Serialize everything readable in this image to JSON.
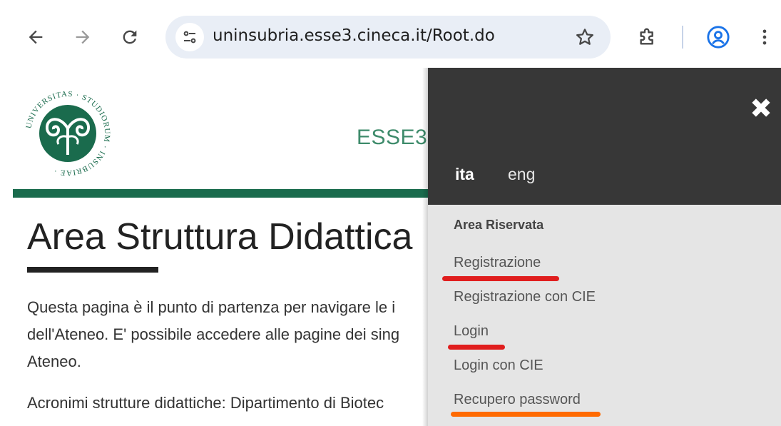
{
  "browser": {
    "url": "uninsubria.esse3.cineca.it/Root.do",
    "icons": {
      "back": "back-arrow-icon",
      "forward": "forward-arrow-icon",
      "reload": "reload-icon",
      "site_settings": "tune-icon",
      "bookmark": "star-icon",
      "extensions": "puzzle-icon",
      "profile": "account-circle-icon",
      "menu": "kebab-menu-icon"
    },
    "colors": {
      "omnibox_bg": "#e9eef6",
      "profile_accent": "#1a73e8"
    }
  },
  "page": {
    "logo": {
      "text": "UNIVERSITAS STUDIORUM INSUBRIAE",
      "color": "#1a6b4d"
    },
    "header_title": "ESSE3",
    "title": "Area Struttura Didattica",
    "intro_lines": [
      "Questa pagina è il punto di partenza per navigare le i",
      "dell'Ateneo. E' possibile accedere alle pagine dei sing",
      "Ateneo."
    ],
    "acronyms": "Acronimi strutture didattiche: Dipartimento di Biotec",
    "colors": {
      "brand_green": "#1a6b4d",
      "title_green": "#3e8b6b"
    }
  },
  "menu": {
    "close_icon": "close-icon",
    "languages": {
      "ita": "ita",
      "eng": "eng"
    },
    "section_title": "Area Riservata",
    "items": [
      {
        "label": "Registrazione",
        "highlight": "#e01e1e"
      },
      {
        "label": "Registrazione con CIE"
      },
      {
        "label": "Login",
        "highlight": "#e01e1e"
      },
      {
        "label": "Login con CIE"
      },
      {
        "label": "Recupero password",
        "highlight": "#ff6a00"
      }
    ],
    "colors": {
      "header_bg": "#373737",
      "body_bg": "#e5e5e5"
    }
  }
}
